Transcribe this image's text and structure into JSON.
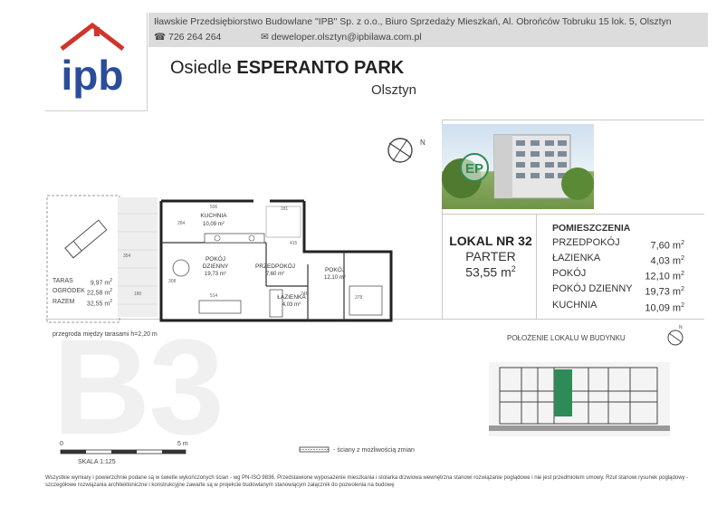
{
  "header": {
    "company_line": "Iławskie Przedsiębiorstwo Budowlane \"IPB\" Sp. z o.o., Biuro Sprzedaży Mieszkań, Al. Obrońców Tobruku 15 lok. 5, Olsztyn",
    "phone": "726 264 264",
    "email": "deweloper.olsztyn@ipbilawa.com.pl",
    "logo_text": "ipb",
    "brand_color": "#2a4d9b",
    "roof_color": "#d0342c"
  },
  "project": {
    "title_prefix": "Osiedle ",
    "title_bold": "ESPERANTO PARK",
    "city": "Olsztyn",
    "render_logo": "EP"
  },
  "unit": {
    "name": "LOKAL NR 32",
    "floor": "PARTER",
    "area": "53,55 m",
    "area_sup": "2",
    "highlight_color": "#2e8b57"
  },
  "rooms": {
    "heading": "POMIESZCZENIA",
    "list": [
      {
        "name": "PRZEDPOKÓJ",
        "area": "7,60 m",
        "sup": "2"
      },
      {
        "name": "ŁAZIENKA",
        "area": "4,03 m",
        "sup": "2"
      },
      {
        "name": "POKÓJ",
        "area": "12,10 m",
        "sup": "2"
      },
      {
        "name": "POKÓJ DZIENNY",
        "area": "19,73 m",
        "sup": "2"
      },
      {
        "name": "KUCHNIA",
        "area": "10,09 m",
        "sup": "2"
      }
    ]
  },
  "plan": {
    "kuchnia": "KUCHNIA",
    "kuchnia_area": "10,09 m",
    "pokoj_dzienny_1": "POKÓJ",
    "pokoj_dzienny_2": "DZIENNY",
    "pokoj_dzienny_area": "19,73 m",
    "przedpokoj": "PRZEDPOKÓJ",
    "przedpokoj_area": "7,60 m",
    "pokoj": "POKÓJ",
    "pokoj_area": "12,10 m",
    "lazienka": "ŁAZIENKA",
    "lazienka_area": "4,03 m",
    "sup": "2",
    "dims": [
      "506",
      "181",
      "415",
      "514",
      "248",
      "378",
      "308",
      "284",
      "354",
      "180"
    ],
    "outdoor": [
      {
        "name": "TARAS",
        "value": "9,97 m",
        "sup": "2"
      },
      {
        "name": "OGRÓDEK",
        "value": "22,58 m",
        "sup": "2"
      },
      {
        "name": "RAZEM",
        "value": "32,55 m",
        "sup": "2"
      }
    ],
    "partition_note": "przegroda między tarasami h=2,20 m",
    "scale_zero": "0",
    "scale_five": "5 m",
    "scale_label": "SKALA 1:125",
    "legend_walls": "- ściany z możliwością zmian"
  },
  "location": {
    "heading": "POŁOŻENIE LOKALU W BUDYNKU"
  },
  "watermark": "B3",
  "compass_letter": "N",
  "footer": {
    "line1": "Wszystkie wymiary i powierzchnie podane są w świetle wykończonych ścian - wg PN-ISO 9836. Przedstawione wyposażenie mieszkania i stolarka drzwiowa wewnętrzna stanowi rozwiązanie poglądowe i nie jest przedmiotem umowy. Rzut stanowi rysunek poglądowy -",
    "line2": "szczegółowe rozwiązania architektoniczne i konstrukcyjne zawarte są w projekcie budowlanym stanowiącym załącznik do pozwolenia na budowę"
  }
}
